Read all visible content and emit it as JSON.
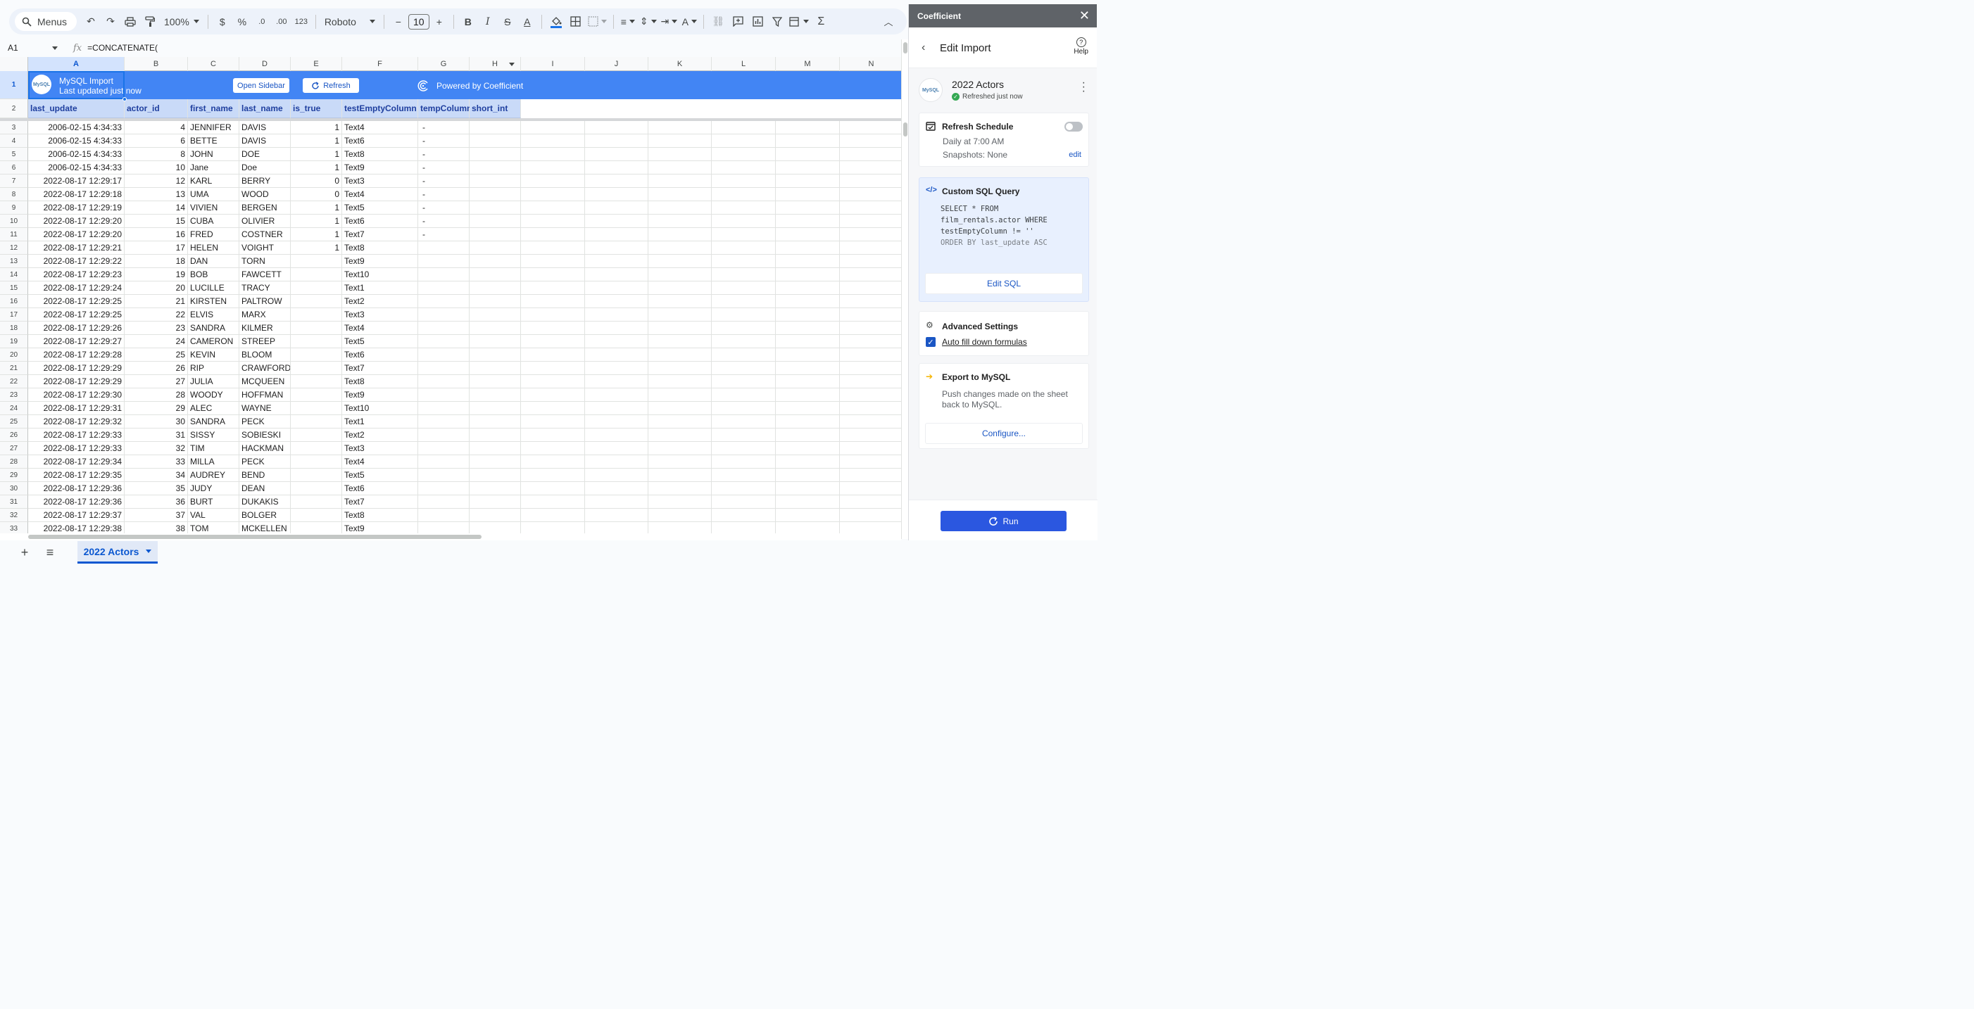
{
  "toolbar": {
    "search_label": "Menus",
    "zoom": "100%",
    "currency": "$",
    "percent": "%",
    "dec_decrease": ".0",
    "dec_increase": ".00",
    "num_format": "123",
    "font": "Roboto",
    "font_size": "10"
  },
  "formula_bar": {
    "cell_ref": "A1",
    "formula": "=CONCATENATE("
  },
  "grid": {
    "columns": [
      "A",
      "B",
      "C",
      "D",
      "E",
      "F",
      "G",
      "H",
      "I",
      "J",
      "K",
      "L",
      "M",
      "N"
    ],
    "banner": {
      "logo_text": "MySQL",
      "title": "MySQL Import",
      "subtitle": "Last updated just now",
      "open_sidebar": "Open Sidebar",
      "refresh": "Refresh",
      "powered": "Powered by Coefficient"
    },
    "headers": [
      "last_update",
      "actor_id",
      "first_name",
      "last_name",
      "is_true",
      "testEmptyColumn",
      "tempColumn",
      "short_int"
    ],
    "row_numbers": [
      "1",
      "2",
      "3",
      "4",
      "5",
      "6",
      "7",
      "8",
      "9",
      "10",
      "11",
      "12",
      "13",
      "14",
      "15",
      "16",
      "17",
      "18",
      "19",
      "20",
      "21",
      "22",
      "23",
      "24",
      "25",
      "26",
      "27",
      "28",
      "29",
      "30",
      "31",
      "32",
      "33"
    ],
    "rows": [
      [
        "2006-02-15 4:34:33",
        "4",
        "JENNIFER",
        "DAVIS",
        "1",
        "Text4",
        "-"
      ],
      [
        "2006-02-15 4:34:33",
        "6",
        "BETTE",
        "DAVIS",
        "1",
        "Text6",
        "-"
      ],
      [
        "2006-02-15 4:34:33",
        "8",
        "JOHN",
        "DOE",
        "1",
        "Text8",
        "-"
      ],
      [
        "2006-02-15 4:34:33",
        "10",
        "Jane",
        "Doe",
        "1",
        "Text9",
        "-"
      ],
      [
        "2022-08-17 12:29:17",
        "12",
        "KARL",
        "BERRY",
        "0",
        "Text3",
        "-"
      ],
      [
        "2022-08-17 12:29:18",
        "13",
        "UMA",
        "WOOD",
        "0",
        "Text4",
        "-"
      ],
      [
        "2022-08-17 12:29:19",
        "14",
        "VIVIEN",
        "BERGEN",
        "1",
        "Text5",
        "-"
      ],
      [
        "2022-08-17 12:29:20",
        "15",
        "CUBA",
        "OLIVIER",
        "1",
        "Text6",
        "-"
      ],
      [
        "2022-08-17 12:29:20",
        "16",
        "FRED",
        "COSTNER",
        "1",
        "Text7",
        "-"
      ],
      [
        "2022-08-17 12:29:21",
        "17",
        "HELEN",
        "VOIGHT",
        "1",
        "Text8",
        ""
      ],
      [
        "2022-08-17 12:29:22",
        "18",
        "DAN",
        "TORN",
        "",
        "Text9",
        ""
      ],
      [
        "2022-08-17 12:29:23",
        "19",
        "BOB",
        "FAWCETT",
        "",
        "Text10",
        ""
      ],
      [
        "2022-08-17 12:29:24",
        "20",
        "LUCILLE",
        "TRACY",
        "",
        "Text1",
        ""
      ],
      [
        "2022-08-17 12:29:25",
        "21",
        "KIRSTEN",
        "PALTROW",
        "",
        "Text2",
        ""
      ],
      [
        "2022-08-17 12:29:25",
        "22",
        "ELVIS",
        "MARX",
        "",
        "Text3",
        ""
      ],
      [
        "2022-08-17 12:29:26",
        "23",
        "SANDRA",
        "KILMER",
        "",
        "Text4",
        ""
      ],
      [
        "2022-08-17 12:29:27",
        "24",
        "CAMERON",
        "STREEP",
        "",
        "Text5",
        ""
      ],
      [
        "2022-08-17 12:29:28",
        "25",
        "KEVIN",
        "BLOOM",
        "",
        "Text6",
        ""
      ],
      [
        "2022-08-17 12:29:29",
        "26",
        "RIP",
        "CRAWFORD",
        "",
        "Text7",
        ""
      ],
      [
        "2022-08-17 12:29:29",
        "27",
        "JULIA",
        "MCQUEEN",
        "",
        "Text8",
        ""
      ],
      [
        "2022-08-17 12:29:30",
        "28",
        "WOODY",
        "HOFFMAN",
        "",
        "Text9",
        ""
      ],
      [
        "2022-08-17 12:29:31",
        "29",
        "ALEC",
        "WAYNE",
        "",
        "Text10",
        ""
      ],
      [
        "2022-08-17 12:29:32",
        "30",
        "SANDRA",
        "PECK",
        "",
        "Text1",
        ""
      ],
      [
        "2022-08-17 12:29:33",
        "31",
        "SISSY",
        "SOBIESKI",
        "",
        "Text2",
        ""
      ],
      [
        "2022-08-17 12:29:33",
        "32",
        "TIM",
        "HACKMAN",
        "",
        "Text3",
        ""
      ],
      [
        "2022-08-17 12:29:34",
        "33",
        "MILLA",
        "PECK",
        "",
        "Text4",
        ""
      ],
      [
        "2022-08-17 12:29:35",
        "34",
        "AUDREY",
        "BEND",
        "",
        "Text5",
        ""
      ],
      [
        "2022-08-17 12:29:36",
        "35",
        "JUDY",
        "DEAN",
        "",
        "Text6",
        ""
      ],
      [
        "2022-08-17 12:29:36",
        "36",
        "BURT",
        "DUKAKIS",
        "",
        "Text7",
        ""
      ],
      [
        "2022-08-17 12:29:37",
        "37",
        "VAL",
        "BOLGER",
        "",
        "Text8",
        ""
      ],
      [
        "2022-08-17 12:29:38",
        "38",
        "TOM",
        "MCKELLEN",
        "",
        "Text9",
        ""
      ]
    ]
  },
  "sheet_tab": {
    "name": "2022 Actors"
  },
  "sidebar": {
    "app_name": "Coefficient",
    "page_title": "Edit Import",
    "help": "Help",
    "import": {
      "logo_text": "MySQL",
      "name": "2022 Actors",
      "status": "Refreshed just now"
    },
    "schedule": {
      "title": "Refresh Schedule",
      "time": "Daily at 7:00 AM",
      "snapshots": "Snapshots: None",
      "edit": "edit"
    },
    "sql": {
      "title": "Custom SQL Query",
      "line1": "SELECT * FROM",
      "line2": "film_rentals.actor WHERE",
      "line3": "testEmptyColumn != ''",
      "line4": "ORDER BY last_update ASC",
      "edit_button": "Edit SQL"
    },
    "advanced": {
      "title": "Advanced Settings",
      "autofill": "Auto fill down formulas"
    },
    "export": {
      "title": "Export to MySQL",
      "description_1": "Push changes made on the sheet",
      "description_2": "back to MySQL.",
      "configure": "Configure..."
    },
    "run": "Run"
  }
}
